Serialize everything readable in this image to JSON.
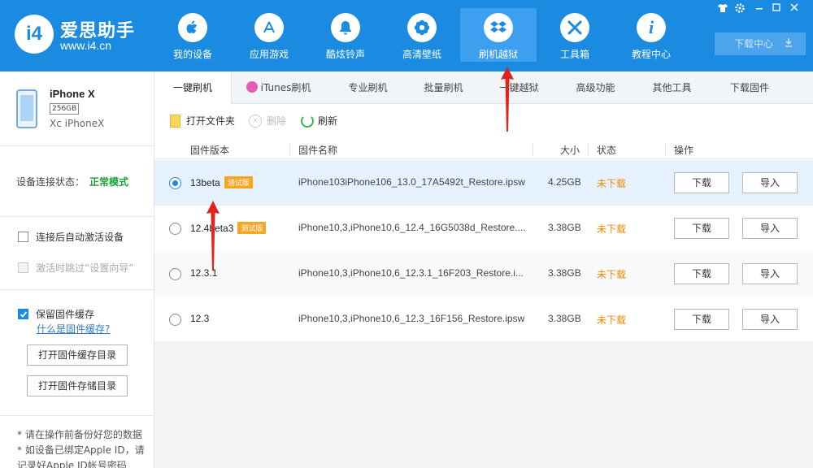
{
  "app": {
    "brand_name": "爱思助手",
    "brand_url": "www.i4.cn",
    "logo_text": "i4"
  },
  "nav": [
    {
      "label": "我的设备",
      "icon": "apple-icon",
      "glyph": ""
    },
    {
      "label": "应用游戏",
      "icon": "app-store-icon",
      "glyph": "A"
    },
    {
      "label": "酷炫铃声",
      "icon": "bell-icon",
      "glyph": "🔔"
    },
    {
      "label": "高清壁纸",
      "icon": "flower-icon",
      "glyph": "✿"
    },
    {
      "label": "刷机越狱",
      "icon": "dropbox-icon",
      "glyph": "◈",
      "active": true
    },
    {
      "label": "工具箱",
      "icon": "tools-icon",
      "glyph": "✕"
    },
    {
      "label": "教程中心",
      "icon": "info-icon",
      "glyph": "i"
    }
  ],
  "window_controls": [
    "shirt-icon",
    "gear-icon",
    "minimize-icon",
    "maximize-icon",
    "close-icon"
  ],
  "download_center": "下载中心",
  "device": {
    "name": "iPhone X",
    "storage": "256GB",
    "model": "Xc iPhoneX"
  },
  "connection": {
    "label": "设备连接状态：",
    "mode": "正常模式"
  },
  "options": {
    "auto_activate": "连接后自动激活设备",
    "skip_setup": "激活时跳过“设置向导”",
    "keep_cache": "保留固件缓存",
    "cache_help": "什么是固件缓存?",
    "open_cache_dir": "打开固件缓存目录",
    "open_storage_dir": "打开固件存储目录"
  },
  "notes": {
    "line1": "* 请在操作前备份好您的数据",
    "line2": "* 如设备已绑定Apple ID，请记录好Apple ID帐号密码"
  },
  "tabs": [
    "一键刷机",
    "iTunes刷机",
    "专业刷机",
    "批量刷机",
    "一键越狱",
    "高级功能",
    "其他工具",
    "下载固件"
  ],
  "toolbar": {
    "open_folder": "打开文件夹",
    "delete": "删除",
    "refresh": "刷新"
  },
  "table": {
    "headers": {
      "version": "固件版本",
      "name": "固件名称",
      "size": "大小",
      "status": "状态",
      "action": "操作"
    },
    "rows": [
      {
        "version": "13beta",
        "badge": "测试版",
        "name": "iPhone103iPhone106_13.0_17A5492t_Restore.ipsw",
        "size": "4.25GB",
        "status": "未下载",
        "download": "下载",
        "import": "导入"
      },
      {
        "version": "12.4beta3",
        "badge": "测试版",
        "name": "iPhone10,3,iPhone10,6_12.4_16G5038d_Restore....",
        "size": "3.38GB",
        "status": "未下载",
        "download": "下载",
        "import": "导入"
      },
      {
        "version": "12.3.1",
        "badge": "",
        "name": "iPhone10,3,iPhone10,6_12.3.1_16F203_Restore.i...",
        "size": "3.38GB",
        "status": "未下载",
        "download": "下载",
        "import": "导入"
      },
      {
        "version": "12.3",
        "badge": "",
        "name": "iPhone10,3,iPhone10,6_12.3_16F156_Restore.ipsw",
        "size": "3.38GB",
        "status": "未下载",
        "download": "下载",
        "import": "导入"
      }
    ]
  },
  "colors": {
    "header_blue": "#1a8be0",
    "annotation_red": "#e0241c",
    "status_orange": "#f08a00",
    "normal_mode_green": "#1aa33a"
  }
}
